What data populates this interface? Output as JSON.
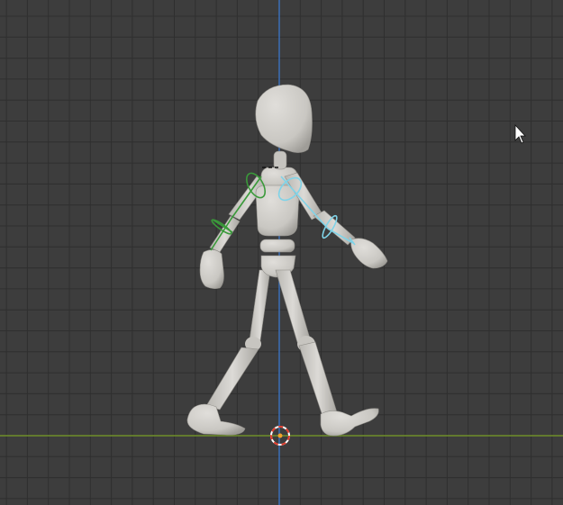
{
  "viewport": {
    "background": "#3d3d3d",
    "grid_color": "#2f2f2f",
    "axis_x_color": "#6f8f2a",
    "axis_z_color": "#3b6fb8"
  },
  "icons": {
    "cursor": "mouse-pointer-icon",
    "origin": "3d-cursor-icon"
  },
  "colors": {
    "body": "#cfcdc8",
    "body_shade": "#a9a7a2",
    "ik_left": "#3a9a3a",
    "ik_right": "#7fd3e8",
    "cursor_ring_red": "#e23c2c",
    "cursor_ring_white": "#ffffff",
    "origin_dot": "#f3a12a"
  }
}
